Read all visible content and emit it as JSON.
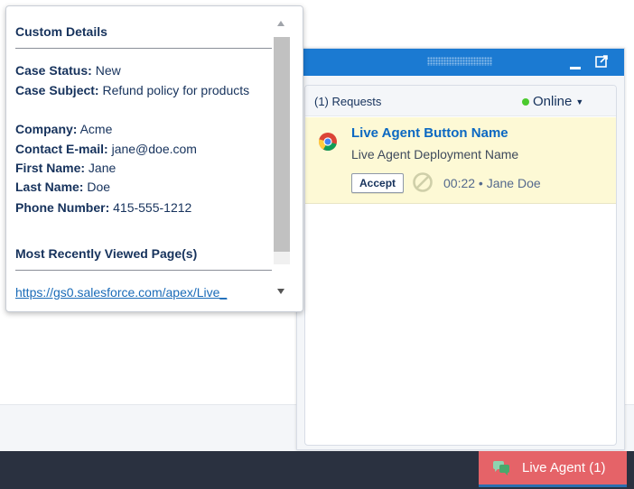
{
  "details": {
    "title": "Custom Details",
    "fields": [
      {
        "label": "Case Status:",
        "value": "New"
      },
      {
        "label": "Case Subject:",
        "value": "Refund policy for products"
      },
      {
        "label": "Company:",
        "value": "Acme"
      },
      {
        "label": "Contact E-mail:",
        "value": "jane@doe.com"
      },
      {
        "label": "First Name:",
        "value": "Jane"
      },
      {
        "label": "Last Name:",
        "value": "Doe"
      },
      {
        "label": "Phone Number:",
        "value": "415-555-1212"
      }
    ],
    "recent_title": "Most Recently Viewed Page(s)",
    "recent_link": "https://gs0.salesforce.com/apex/Live_"
  },
  "live_agent": {
    "requests_label": "(1) Requests",
    "status": "Online",
    "status_color": "#4bca2f",
    "request": {
      "button_name": "Live Agent Button Name",
      "deployment_name": "Live Agent Deployment Name",
      "accept_label": "Accept",
      "meta": "00:22 • Jane Doe"
    }
  },
  "utility_bar": {
    "tab_label": "Live Agent (1)",
    "tab_color": "#e56368"
  },
  "icons": [
    "chrome-browser-icon",
    "decline-icon",
    "chat-icon",
    "minimize-icon",
    "popout-icon"
  ]
}
